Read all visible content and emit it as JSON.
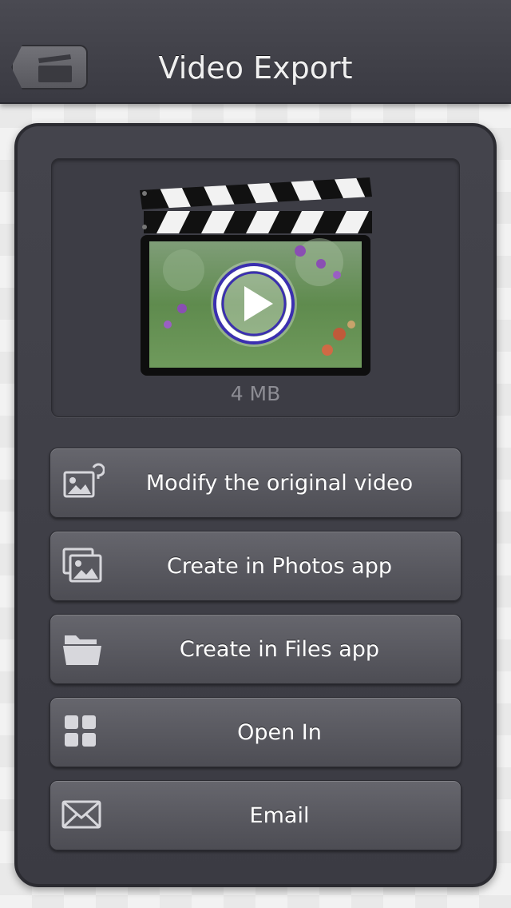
{
  "header": {
    "title": "Video Export",
    "back_icon": "clapperboard-icon"
  },
  "preview": {
    "thumbnail": "video-thumbnail-butterfly",
    "file_size": "4 MB"
  },
  "actions": [
    {
      "label": "Modify the original video",
      "icon": "modify-image-icon"
    },
    {
      "label": "Create in Photos app",
      "icon": "photos-icon"
    },
    {
      "label": "Create in Files app",
      "icon": "folder-icon"
    },
    {
      "label": "Open In",
      "icon": "grid-icon"
    },
    {
      "label": "Email",
      "icon": "envelope-icon"
    }
  ],
  "colors": {
    "nav_bar": "#3f3f47",
    "panel": "#404048",
    "button": "#5a5a61",
    "play_ring": "#3b2fb0"
  }
}
